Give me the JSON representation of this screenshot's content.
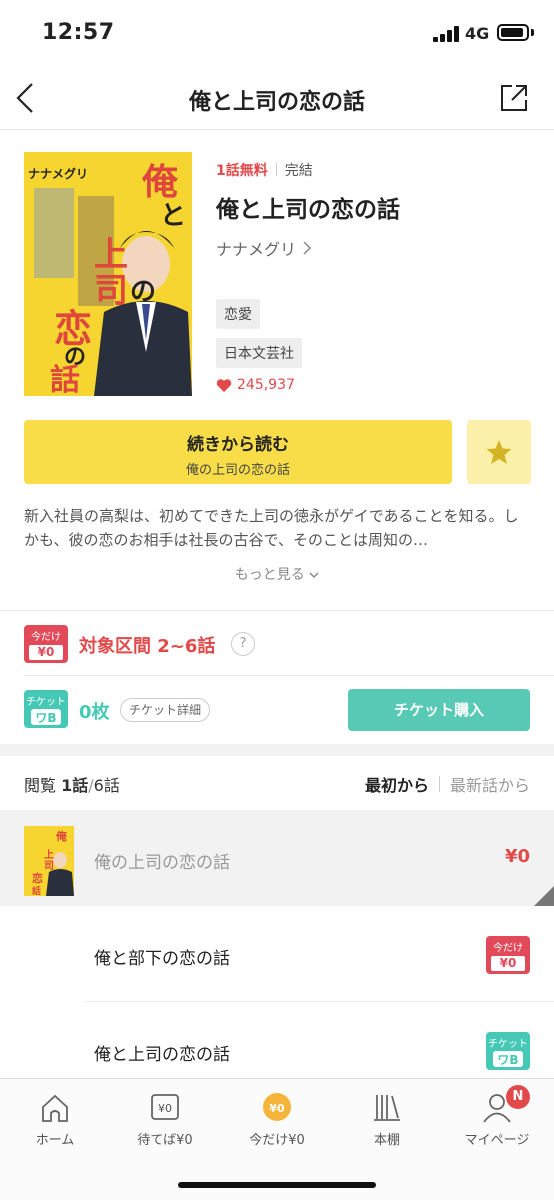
{
  "status_bar": {
    "time": "12:57",
    "network": "4G"
  },
  "nav": {
    "title": "俺と上司の恋の話"
  },
  "book": {
    "free_badge": "1話無料",
    "status": "完結",
    "title": "俺と上司の恋の話",
    "author": "ナナメグリ",
    "genre": "恋愛",
    "publisher": "日本文芸社",
    "likes": "245,937",
    "cover_author": "ナナメグリ",
    "cover_title_chars": [
      "俺",
      "と",
      "上",
      "司",
      "の",
      "恋",
      "の",
      "話"
    ]
  },
  "read_button": {
    "label": "続きから読む",
    "sub": "俺の上司の恋の話"
  },
  "description": "新入社員の高梨は、初めてできた上司の徳永がゲイであることを知る。しかも、彼の恋のお相手は社長の古谷で、そのことは周知の…",
  "more_label": "もっと見る",
  "campaign": {
    "icon_top": "今だけ",
    "icon_bottom": "¥0",
    "text": "対象区間 2~6話",
    "help": "?"
  },
  "ticket": {
    "icon_top": "チケット",
    "count": "0枚",
    "detail_label": "チケット詳細",
    "buy_label": "チケット購入"
  },
  "episodes_header": {
    "progress_prefix": "閲覧",
    "read": "1話",
    "separator": "/",
    "total": "6話",
    "sort_first": "最初から",
    "sort_latest": "最新話から"
  },
  "episodes": [
    {
      "title": "俺の上司の恋の話",
      "price": "¥0"
    },
    {
      "title": "俺と部下の恋の話",
      "badge_top": "今だけ",
      "badge_bottom": "¥0"
    },
    {
      "title": "俺と上司の恋の話",
      "badge_top": "チケット"
    }
  ],
  "tabs": [
    {
      "label": "ホーム",
      "icon": "home-icon"
    },
    {
      "label": "待てば¥0",
      "icon": "wait-free-icon",
      "icon_text": "¥0"
    },
    {
      "label": "今だけ¥0",
      "icon": "limited-free-icon",
      "icon_text": "¥0"
    },
    {
      "label": "本棚",
      "icon": "bookshelf-icon"
    },
    {
      "label": "マイページ",
      "icon": "profile-icon",
      "badge": "N"
    }
  ],
  "colors": {
    "accent_yellow": "#f8dd48",
    "campaign_red": "#e24a4a",
    "ticket_teal": "#58c9b5",
    "tab_coin": "#f5b43a"
  }
}
